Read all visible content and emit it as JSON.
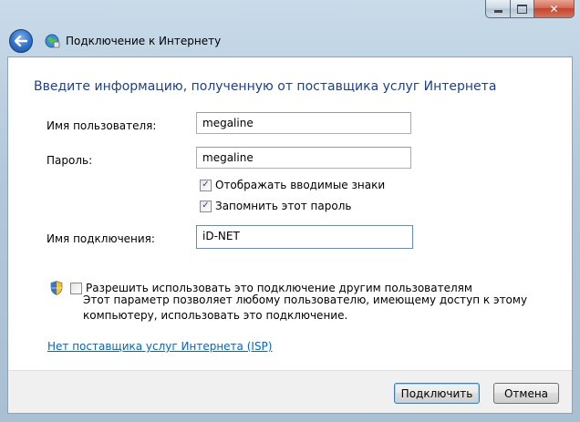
{
  "window": {
    "title": "Подключение к Интернету",
    "close_glyph": "✕"
  },
  "form": {
    "heading": "Введите информацию, полученную от поставщика услуг Интернета",
    "username_label": "Имя пользователя:",
    "username_value": "megaline",
    "password_label": "Пароль:",
    "password_value": "megaline",
    "show_chars_label": "Отображать вводимые знаки",
    "show_chars_checked": true,
    "remember_label": "Запомнить этот пароль",
    "remember_checked": true,
    "connection_name_label": "Имя подключения:",
    "connection_name_value": "iD-NET",
    "allow_others_label": "Разрешить использовать это подключение другим пользователям",
    "allow_others_checked": false,
    "allow_others_desc": "Этот параметр позволяет любому пользователю, имеющему доступ к этому компьютеру, использовать это подключение.",
    "no_isp_link": "Нет поставщика услуг Интернета (ISP)"
  },
  "buttons": {
    "connect": "Подключить",
    "cancel": "Отмена"
  },
  "check_glyph": "✓",
  "colors": {
    "heading": "#1e3f8f",
    "link": "#0066cc",
    "close_button": "#c2462b"
  }
}
